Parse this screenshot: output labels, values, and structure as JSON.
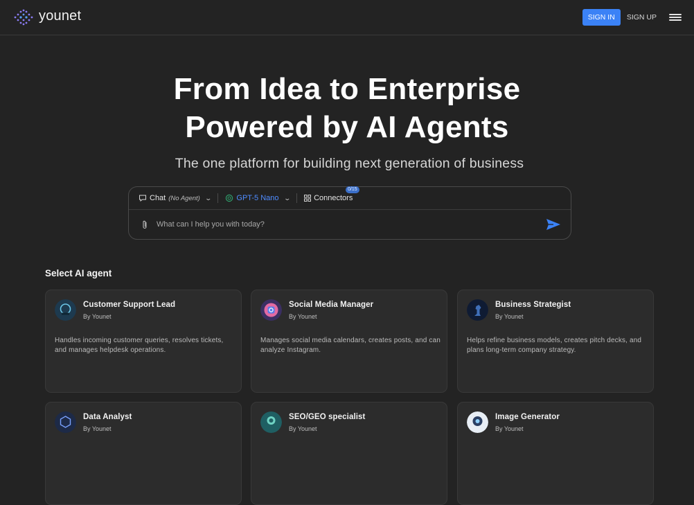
{
  "header": {
    "brand_name": "younet",
    "sign_in_label": "SIGN IN",
    "sign_up_label": "SIGN UP",
    "menu_icon": "hamburger-menu-icon"
  },
  "hero": {
    "title_line1": "From Idea to Enterprise",
    "title_line2": "Powered by AI Agents",
    "subtitle": "The one platform for building next generation of business"
  },
  "chat": {
    "mode_label": "Chat",
    "mode_sub": "(No Agent)",
    "model_label": "GPT-5 Nano",
    "connectors_label": "Connectors",
    "connectors_badge": "0/15",
    "placeholder": "What can I help you with today?",
    "accent_color": "#3b82f6"
  },
  "agents": {
    "section_title": "Select AI agent",
    "items": [
      {
        "name": "Customer Support Lead",
        "by": "By Younet",
        "desc": "Handles incoming customer queries, resolves tickets, and manages helpdesk operations."
      },
      {
        "name": "Social Media Manager",
        "by": "By Younet",
        "desc": "Manages social media calendars, creates posts, and can analyze Instagram."
      },
      {
        "name": "Business Strategist",
        "by": "By Younet",
        "desc": "Helps refine business models, creates pitch decks, and plans long-term company strategy."
      },
      {
        "name": "Data Analyst",
        "by": "By Younet",
        "desc": ""
      },
      {
        "name": "SEO/GEO specialist",
        "by": "By Younet",
        "desc": ""
      },
      {
        "name": "Image Generator",
        "by": "By Younet",
        "desc": ""
      }
    ]
  }
}
